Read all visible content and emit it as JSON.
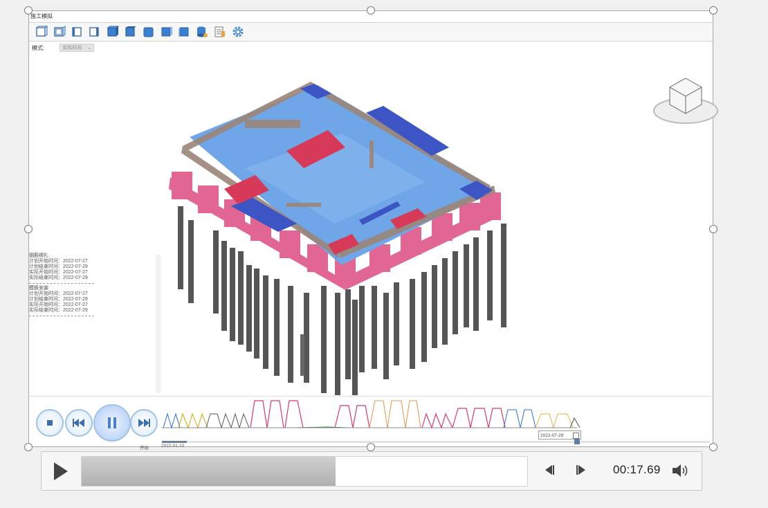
{
  "window": {
    "title": "施工模拟",
    "mode_label": "模式:",
    "mode_value": "实际时间"
  },
  "toolbar": {
    "icons": [
      "view-front-icon",
      "view-back-icon",
      "view-left-icon",
      "view-right-icon",
      "view-top-icon",
      "view-bottom-icon",
      "view-iso-1-icon",
      "view-iso-2-icon",
      "view-iso-3-icon",
      "database-icon",
      "report-icon",
      "settings-icon"
    ]
  },
  "info_panel": {
    "section1_title": "钢筋绑扎",
    "section1_lines": [
      "计划开始时间：2022-07-27",
      "计划结束时间：2022-07-29",
      "实际开始时间：2022-07-27",
      "实际结束时间：2022-07-29"
    ],
    "section2_title": "模板安装",
    "section2_lines": [
      "计划开始时间：2022-07-27",
      "计划结束时间：2022-07-29",
      "实际开始时间：2022-07-27",
      "实际结束时间：2022-07-29"
    ]
  },
  "playback": {
    "date_value": "2022-07-29",
    "start_label": "开始",
    "start_date": "2022-01-10",
    "slider_progress": 0.045,
    "thumb_progress": 0.75
  },
  "player": {
    "time": "00:17.69",
    "progress": 0.57
  },
  "colors": {
    "accent": "#4a8fd0",
    "pink": "#e05a8a",
    "blue_slab": "#6fa6e8",
    "dark_blue": "#3d55c4",
    "column": "#555555",
    "wall": "#9b8577"
  }
}
